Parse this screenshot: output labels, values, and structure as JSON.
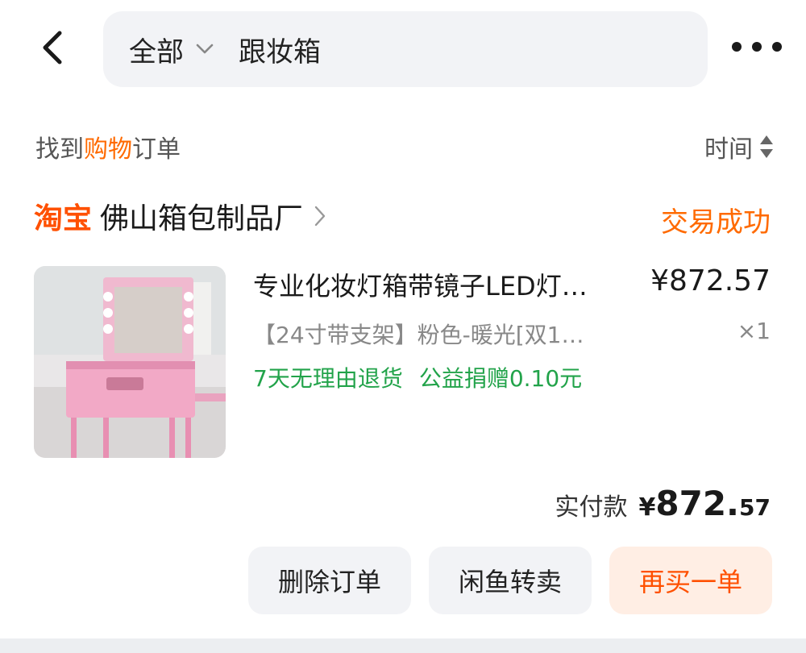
{
  "header": {
    "back_icon": "chevron-left-icon",
    "search_scope": "全部",
    "search_scope_icon": "chevron-down-icon",
    "search_query": "跟妆箱",
    "more_icon": "ellipsis-icon"
  },
  "results": {
    "prefix": "找到",
    "highlight": "购物",
    "suffix": "订单",
    "sort_label": "时间",
    "sort_icon": "sort-updown-icon"
  },
  "order": {
    "platform": "淘宝",
    "shop_name": "佛山箱包制品厂",
    "status": "交易成功",
    "item": {
      "title": "专业化妆灯箱带镜子LED灯…",
      "price": "¥872.57",
      "sku": "【24寸带支架】粉色-暖光[双1…",
      "quantity": "×1",
      "tags": [
        "7天无理由退货",
        "公益捐赠0.10元"
      ],
      "image": "pink-makeup-light-case-image"
    },
    "total": {
      "label": "实付款",
      "currency": "¥",
      "integer": "872.",
      "decimal": "57"
    },
    "actions": {
      "delete": "删除订单",
      "resell": "闲鱼转卖",
      "rebuy": "再买一单"
    }
  },
  "colors": {
    "accent_orange": "#ff6a00",
    "taobao_orange": "#ff5000",
    "tag_green": "#22a34a",
    "search_bg": "#f2f3f6"
  }
}
